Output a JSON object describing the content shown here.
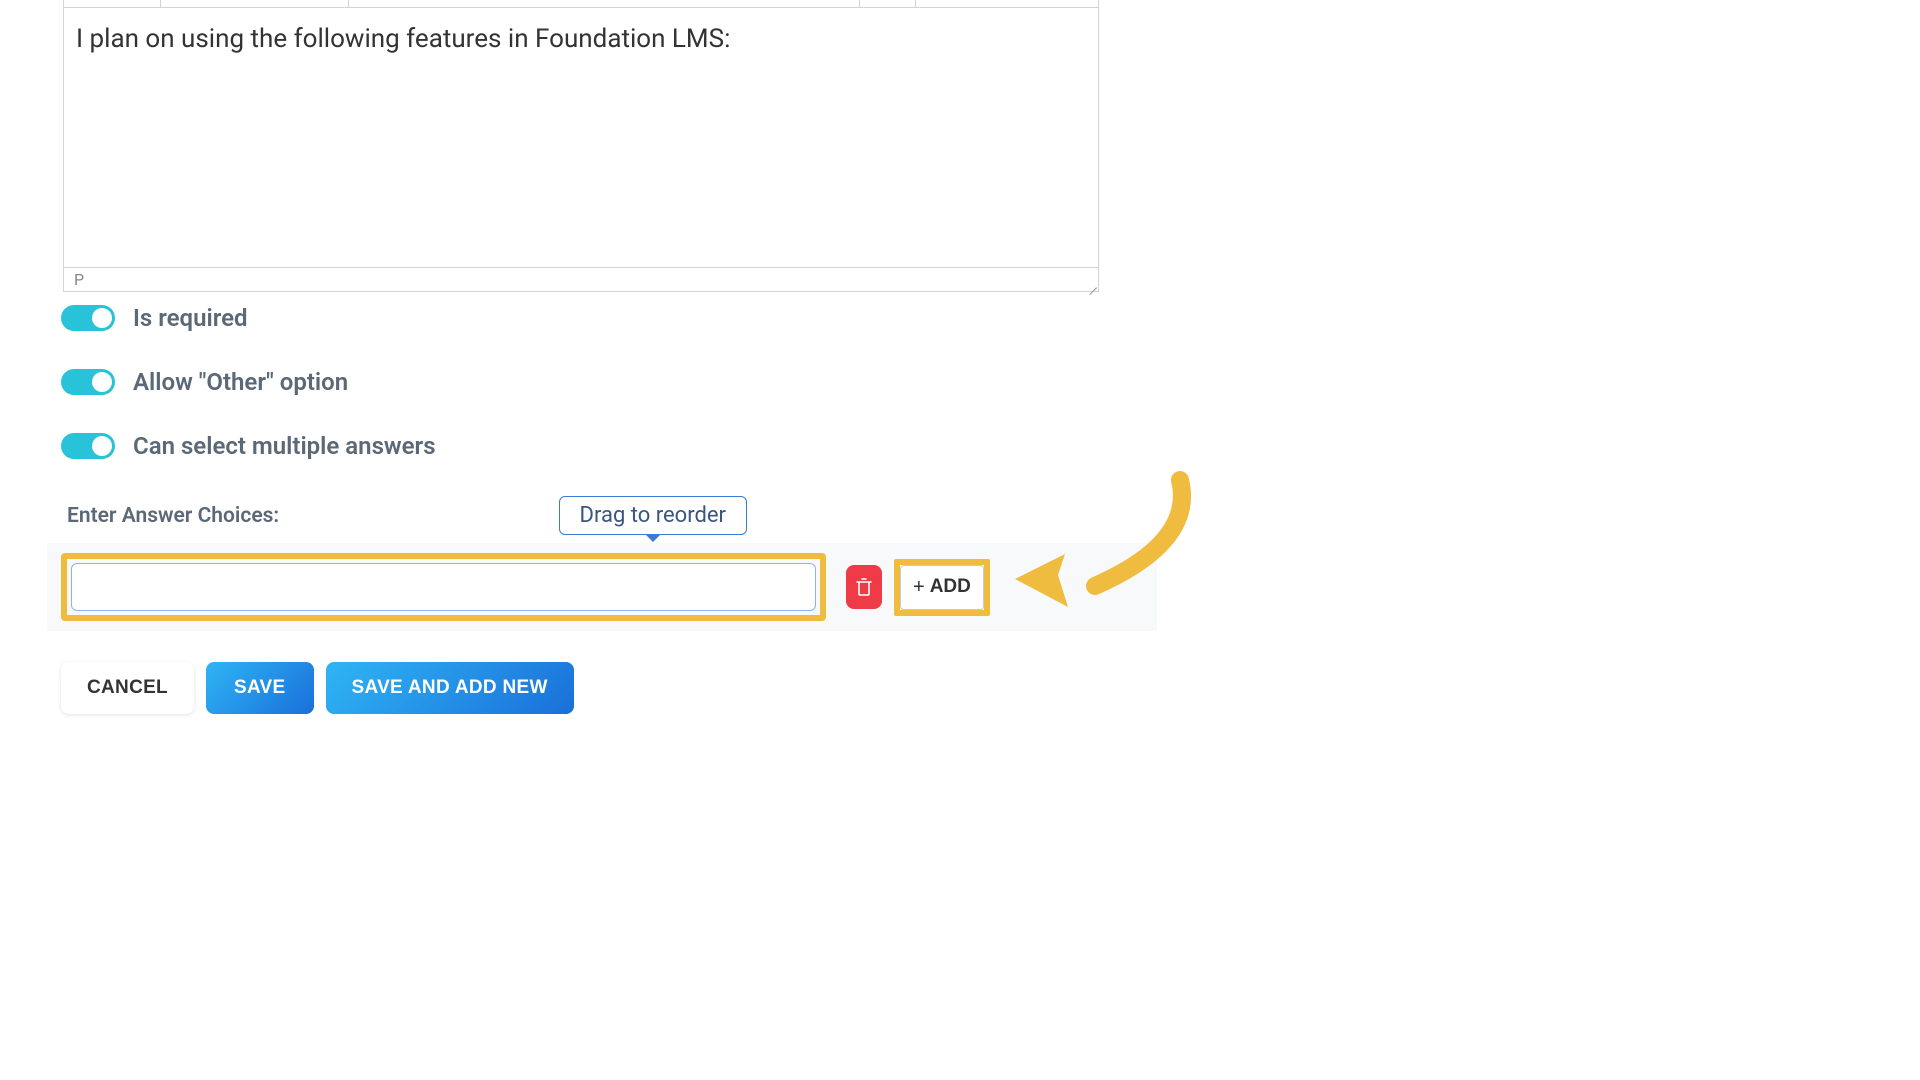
{
  "editor": {
    "content": "I plan on using the following features in Foundation LMS:",
    "status_path": "P"
  },
  "toggles": {
    "is_required": {
      "label": "Is required",
      "on": true
    },
    "allow_other": {
      "label": "Allow \"Other\" option",
      "on": true
    },
    "multiple_answers": {
      "label": "Can select multiple answers",
      "on": true
    }
  },
  "choices": {
    "header_label": "Enter Answer Choices:",
    "drag_hint": "Drag to reorder",
    "input_value": "",
    "add_label": "ADD"
  },
  "actions": {
    "cancel": "CANCEL",
    "save": "SAVE",
    "save_new": "SAVE AND ADD NEW"
  }
}
